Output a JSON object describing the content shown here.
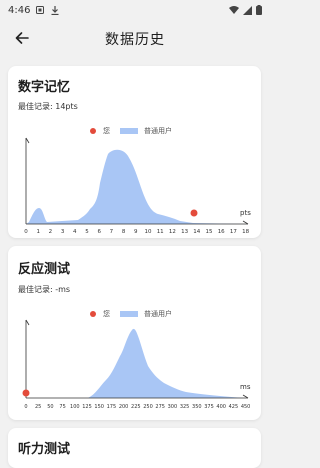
{
  "status_bar": {
    "time": "4:46"
  },
  "header": {
    "title": "数据历史"
  },
  "colors": {
    "you_marker": "#e34b3b",
    "fill": "#a9c6f5",
    "axis": "#333333"
  },
  "icons": [
    "back-arrow-icon",
    "game-icon",
    "download-icon",
    "wifi-icon",
    "signal-icon",
    "battery-icon"
  ],
  "cards": [
    {
      "title": "数字记忆",
      "best_record": "最佳记录: 14pts",
      "legend": {
        "you": "您",
        "users": "普通用户"
      },
      "unit": "pts",
      "ticks": [
        "0",
        "1",
        "2",
        "3",
        "4",
        "5",
        "6",
        "7",
        "8",
        "9",
        "10",
        "11",
        "12",
        "13",
        "14",
        "15",
        "16",
        "17",
        "18"
      ],
      "you_value": 14
    },
    {
      "title": "反应测试",
      "best_record": "最佳记录: -ms",
      "legend": {
        "you": "您",
        "users": "普通用户"
      },
      "unit": "ms",
      "ticks": [
        "0",
        "25",
        "50",
        "75",
        "100",
        "125",
        "150",
        "175",
        "200",
        "225",
        "250",
        "275",
        "300",
        "325",
        "350",
        "375",
        "400",
        "425",
        "450"
      ],
      "you_value": 0
    },
    {
      "title": "听力测试"
    }
  ]
}
